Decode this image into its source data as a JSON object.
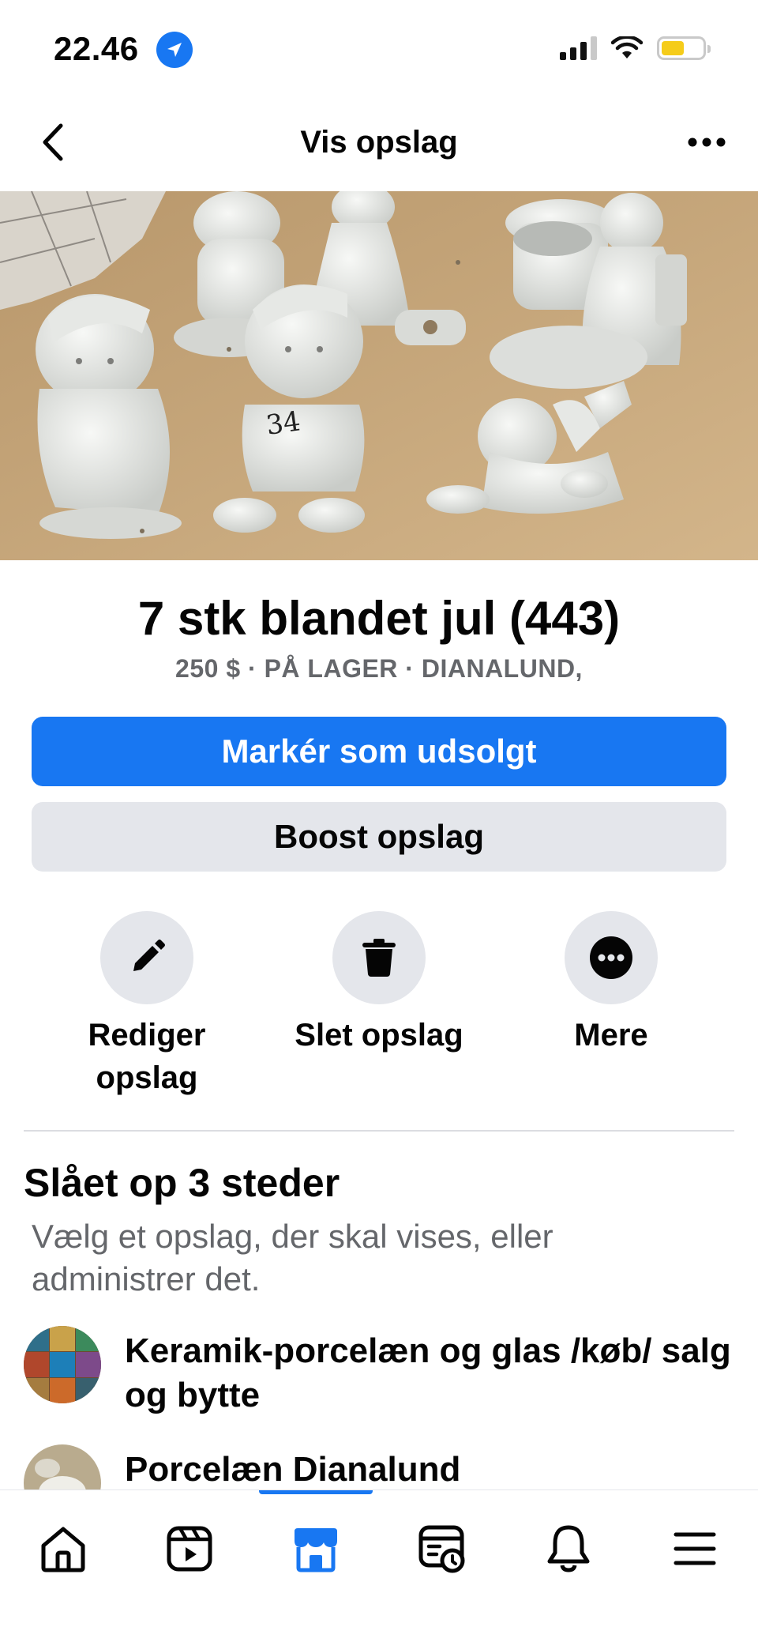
{
  "status_bar": {
    "time": "22.46",
    "location_icon": "location-arrow-icon",
    "signal_icon": "cellular-signal-icon",
    "wifi_icon": "wifi-icon",
    "battery_icon": "battery-icon",
    "battery_color": "#f5cc1a"
  },
  "nav": {
    "title": "Vis opslag",
    "back_icon": "chevron-left-icon",
    "more_icon": "ellipsis-icon"
  },
  "listing": {
    "title": "7 stk blandet jul (443)",
    "meta": "250 $ · PÅ LAGER · DIANALUND,",
    "photo_label": "34"
  },
  "buttons": {
    "mark_sold": "Markér som udsolgt",
    "boost": "Boost opslag"
  },
  "actions": [
    {
      "label": "Rediger opslag",
      "icon": "pencil-icon"
    },
    {
      "label": "Slet opslag",
      "icon": "trash-icon"
    },
    {
      "label": "Mere",
      "icon": "more-circle-icon"
    }
  ],
  "posted": {
    "title": "Slået op 3 steder",
    "subtitle": "Vælg et opslag, der skal vises, eller administrer det.",
    "groups": [
      {
        "name": "Keramik-porcelæn og glas /køb/ salg og bytte"
      },
      {
        "name": "Porcelæn Dianalund"
      }
    ]
  },
  "tabbar": {
    "tabs": [
      {
        "icon": "home-icon"
      },
      {
        "icon": "video-icon"
      },
      {
        "icon": "marketplace-icon",
        "active": true
      },
      {
        "icon": "feeds-icon"
      },
      {
        "icon": "bell-icon"
      },
      {
        "icon": "menu-icon"
      }
    ],
    "accent": "#1877f2"
  },
  "colors": {
    "primary": "#1877f2",
    "secondary_bg": "#e4e6eb",
    "muted_text": "#65676b"
  }
}
